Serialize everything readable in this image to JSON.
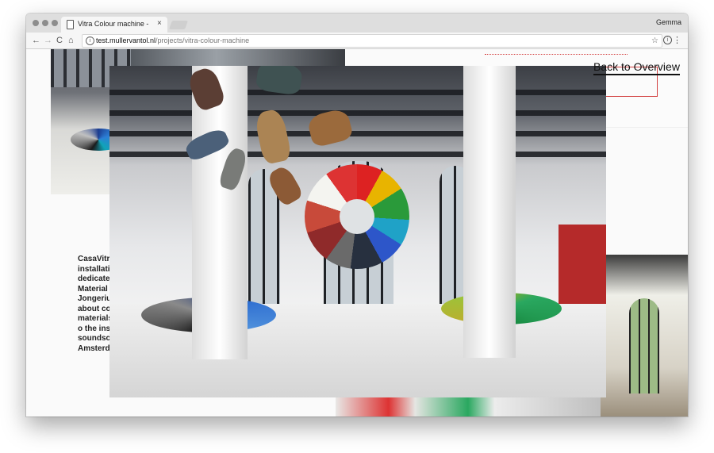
{
  "browser": {
    "tab_title": "Vitra Colour machine - Müller",
    "tab_close": "×",
    "profile_name": "Gemma",
    "url_host": "test.mullervantol.nl",
    "url_path": "/projects/vitra-colour-machine",
    "nav": {
      "back": "←",
      "forward": "→",
      "reload": "C",
      "home": "⌂"
    },
    "star": "☆",
    "info": "i",
    "menu": "⋮"
  },
  "page": {
    "back_link": "Back to Overview",
    "body_lines": [
      "CasaVitra",
      "installati",
      "dedicate",
      "Material",
      "Jongeriu",
      "about co",
      "materials",
      "o the inst",
      "soundsca",
      "Amsterd"
    ]
  },
  "colors": {
    "accent_red": "#d34040",
    "chrome_bg": "#dedede"
  }
}
